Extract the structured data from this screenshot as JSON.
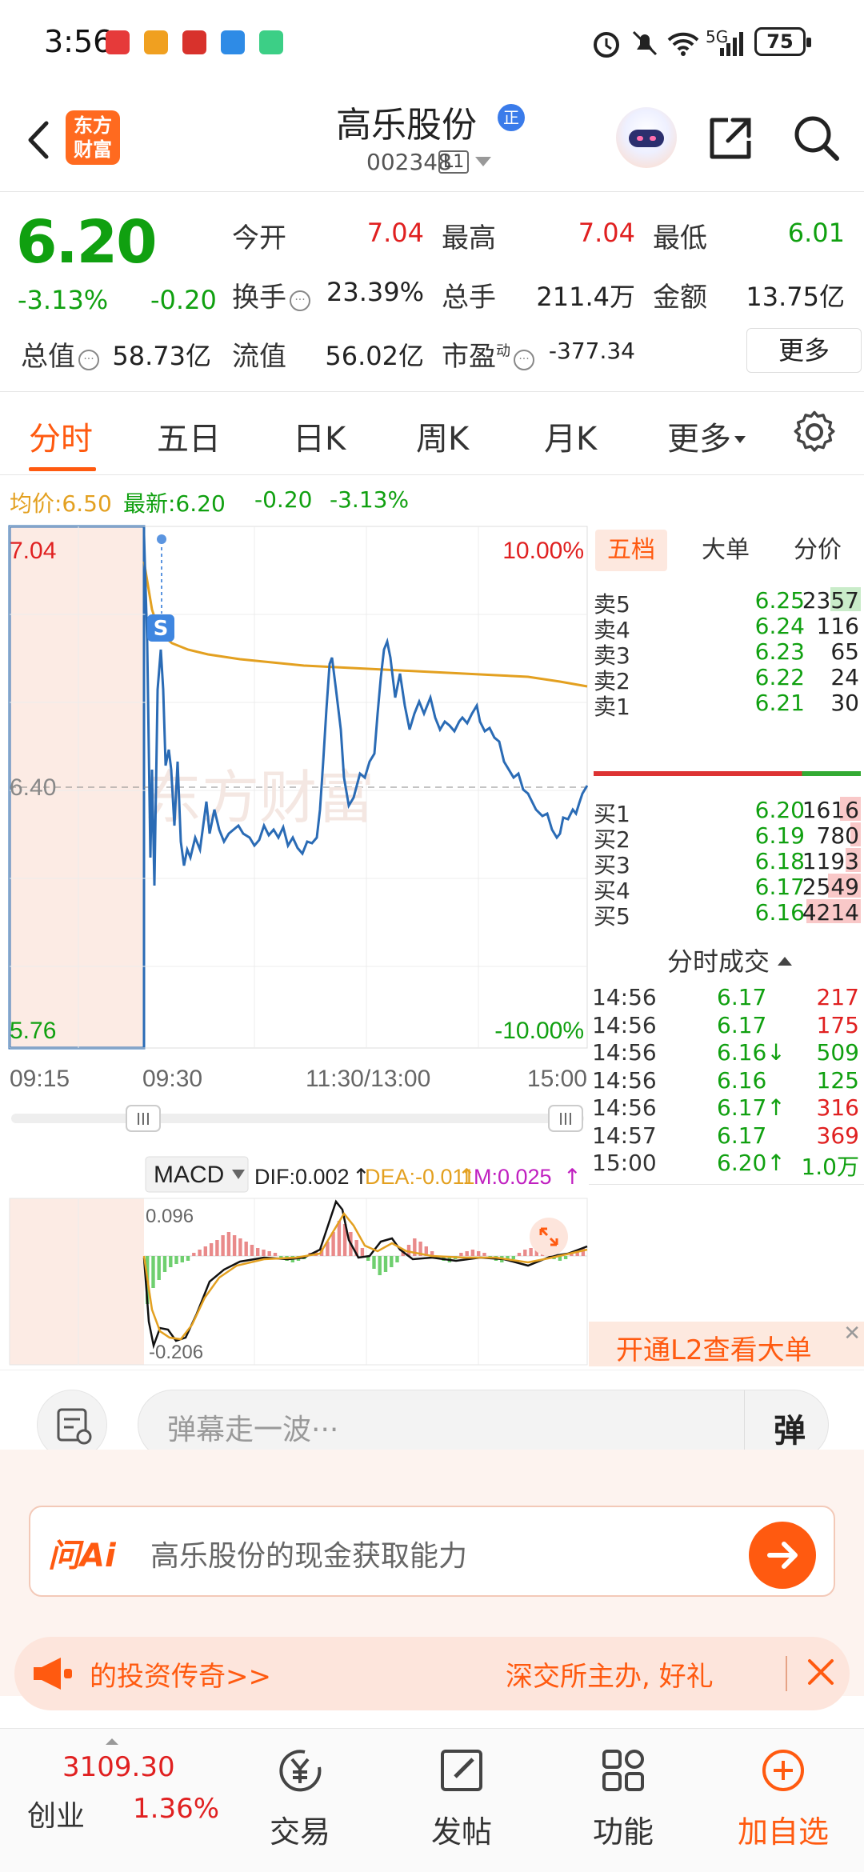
{
  "status_bar": {
    "time": "3:56",
    "network": "5G",
    "battery": "75"
  },
  "header": {
    "stock_name": "高乐股份",
    "badge": "正",
    "stock_code": "002348",
    "level_badge": "L1",
    "logo_line1": "东方",
    "logo_line2": "财富"
  },
  "quote": {
    "price": "6.20",
    "change_pct": "-3.13%",
    "change_amt": "-0.20",
    "open_label": "今开",
    "open": "7.04",
    "high_label": "最高",
    "high": "7.04",
    "low_label": "最低",
    "low": "6.01",
    "turnover_label": "换手",
    "turnover": "23.39%",
    "volume_label": "总手",
    "volume": "211.4万",
    "amount_label": "金额",
    "amount": "13.75亿",
    "mktcap_label": "总值",
    "mktcap": "58.73亿",
    "float_label": "流值",
    "float": "56.02亿",
    "pe_label": "市盈",
    "pe_sup": "动",
    "pe": "-377.34",
    "more_label": "更多"
  },
  "tabs": [
    {
      "label": "分时",
      "active": true
    },
    {
      "label": "五日"
    },
    {
      "label": "日K"
    },
    {
      "label": "周K"
    },
    {
      "label": "月K"
    },
    {
      "label": "更多"
    }
  ],
  "info_line": {
    "avg_label": "均价:6.50",
    "latest_label": "最新:6.20",
    "change": "-0.20",
    "pct": "-3.13%"
  },
  "chart": {
    "y_top": "7.04",
    "y_mid": "6.40",
    "y_bottom": "5.76",
    "pct_top": "10.00%",
    "pct_bottom": "-10.00%",
    "x_labels": [
      "09:15",
      "09:30",
      "11:30/13:00",
      "15:00"
    ],
    "watermark": "东方财富",
    "marker": "S",
    "macd": {
      "name": "MACD",
      "dif": "DIF:0.002",
      "dea": "DEA:-0.011",
      "m": "M:0.025",
      "top": "0.096",
      "bottom": "-0.206"
    }
  },
  "chart_data": {
    "type": "line",
    "title": "",
    "x": [
      "09:15",
      "09:30",
      "11:30/13:00",
      "15:00"
    ],
    "series": [
      {
        "name": "最新",
        "values": [
          7.04,
          6.6,
          6.45,
          6.26
        ]
      },
      {
        "name": "均价",
        "values": [
          7.04,
          6.58,
          6.49,
          6.5
        ]
      }
    ],
    "ylim": [
      5.76,
      7.04
    ],
    "reference": 6.4,
    "grid": true
  },
  "order_book": {
    "tabs": [
      "五档",
      "大单",
      "分价"
    ],
    "sell": [
      {
        "label": "卖5",
        "price": "6.25",
        "vol": "2357"
      },
      {
        "label": "卖4",
        "price": "6.24",
        "vol": "116"
      },
      {
        "label": "卖3",
        "price": "6.23",
        "vol": "65"
      },
      {
        "label": "卖2",
        "price": "6.22",
        "vol": "24"
      },
      {
        "label": "卖1",
        "price": "6.21",
        "vol": "30"
      }
    ],
    "buy": [
      {
        "label": "买1",
        "price": "6.20",
        "vol": "1616"
      },
      {
        "label": "买2",
        "price": "6.19",
        "vol": "780"
      },
      {
        "label": "买3",
        "price": "6.18",
        "vol": "1193"
      },
      {
        "label": "买4",
        "price": "6.17",
        "vol": "2549"
      },
      {
        "label": "买5",
        "price": "6.16",
        "vol": "4214"
      }
    ],
    "trades_title": "分时成交",
    "trades": [
      {
        "time": "14:56",
        "price": "6.17",
        "vol": "217",
        "pcolor": "green",
        "vcolor": "red"
      },
      {
        "time": "14:56",
        "price": "6.17",
        "vol": "175",
        "pcolor": "green",
        "vcolor": "red"
      },
      {
        "time": "14:56",
        "price": "6.16↓",
        "vol": "509",
        "pcolor": "green",
        "vcolor": "green"
      },
      {
        "time": "14:56",
        "price": "6.16",
        "vol": "125",
        "pcolor": "green",
        "vcolor": "green"
      },
      {
        "time": "14:56",
        "price": "6.17↑",
        "vol": "316",
        "pcolor": "green",
        "vcolor": "red"
      },
      {
        "time": "14:57",
        "price": "6.17",
        "vol": "369",
        "pcolor": "green",
        "vcolor": "red"
      },
      {
        "time": "15:00",
        "price": "6.20↑",
        "vol": "1.0万",
        "pcolor": "green",
        "vcolor": "green"
      }
    ],
    "l2_text": "开通L2查看大单"
  },
  "danmaku": {
    "placeholder": "弹幕走一波···",
    "button": "弹"
  },
  "ask_ai": {
    "logo": "问Ai",
    "text": "高乐股份的现金获取能力"
  },
  "marquee": {
    "left": "的投资传奇>>",
    "right": "深交所主办, 好礼"
  },
  "bottom_nav": {
    "index_value": "3109.30",
    "index_name": "创业",
    "index_pct": "1.36%",
    "items": [
      "交易",
      "发帖",
      "功能",
      "加自选"
    ]
  },
  "colors": {
    "up": "#e02020",
    "down": "#10a010",
    "accent": "#ff5a10",
    "line": "#2a6bb5",
    "avg": "#e3a020"
  }
}
